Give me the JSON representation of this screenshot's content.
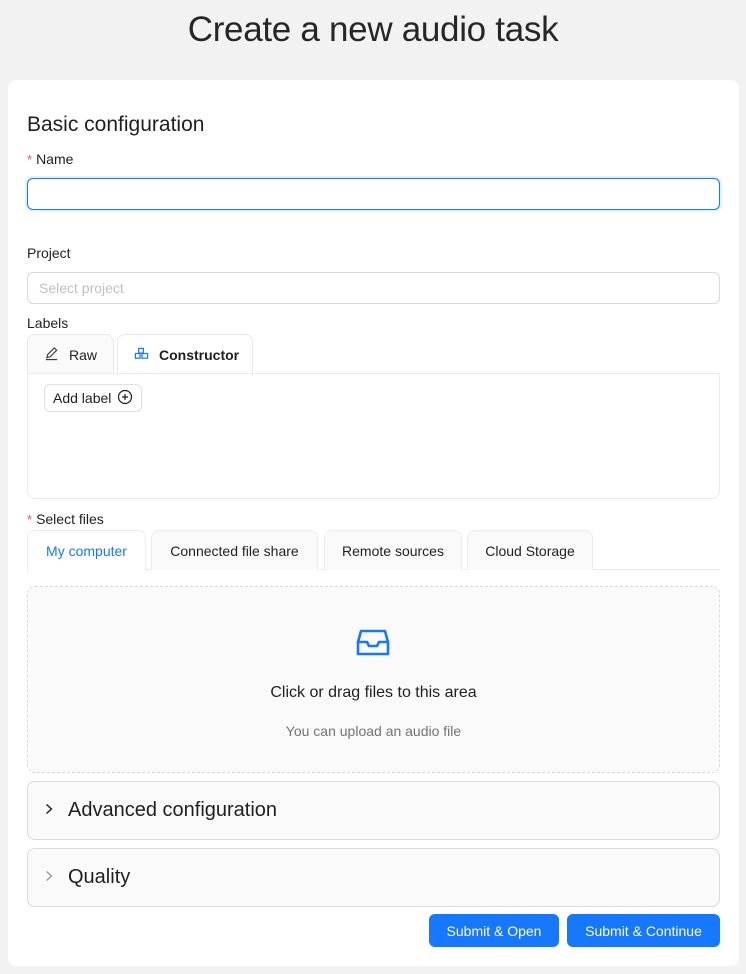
{
  "page": {
    "title": "Create a new audio task"
  },
  "basic": {
    "section_title": "Basic configuration",
    "name_label": "Name",
    "name_value": "",
    "required_mark": "*",
    "project_label": "Project",
    "project_placeholder": "Select project",
    "labels_label": "Labels"
  },
  "labels_tabs": [
    {
      "label": "Raw",
      "icon": "edit-icon",
      "active": false
    },
    {
      "label": "Constructor",
      "icon": "constructor-icon",
      "active": true
    }
  ],
  "add_label": {
    "label": "Add label",
    "icon": "plus-circle-icon"
  },
  "files": {
    "label": "Select files",
    "tabs": [
      {
        "label": "My computer",
        "active": true
      },
      {
        "label": "Connected file share",
        "active": false
      },
      {
        "label": "Remote sources",
        "active": false
      },
      {
        "label": "Cloud Storage",
        "active": false
      }
    ],
    "drop_text": "Click or drag files to this area",
    "drop_hint": "You can upload an audio file",
    "drop_icon": "inbox-icon"
  },
  "collapses": [
    {
      "title": "Advanced configuration",
      "icon": "chevron-right-icon"
    },
    {
      "title": "Quality",
      "icon": "chevron-right-icon"
    }
  ],
  "actions": {
    "submit_open": "Submit & Open",
    "submit_continue": "Submit & Continue"
  },
  "colors": {
    "primary": "#1677ff",
    "required": "#ff4d4f",
    "background": "#f2f2f2"
  }
}
